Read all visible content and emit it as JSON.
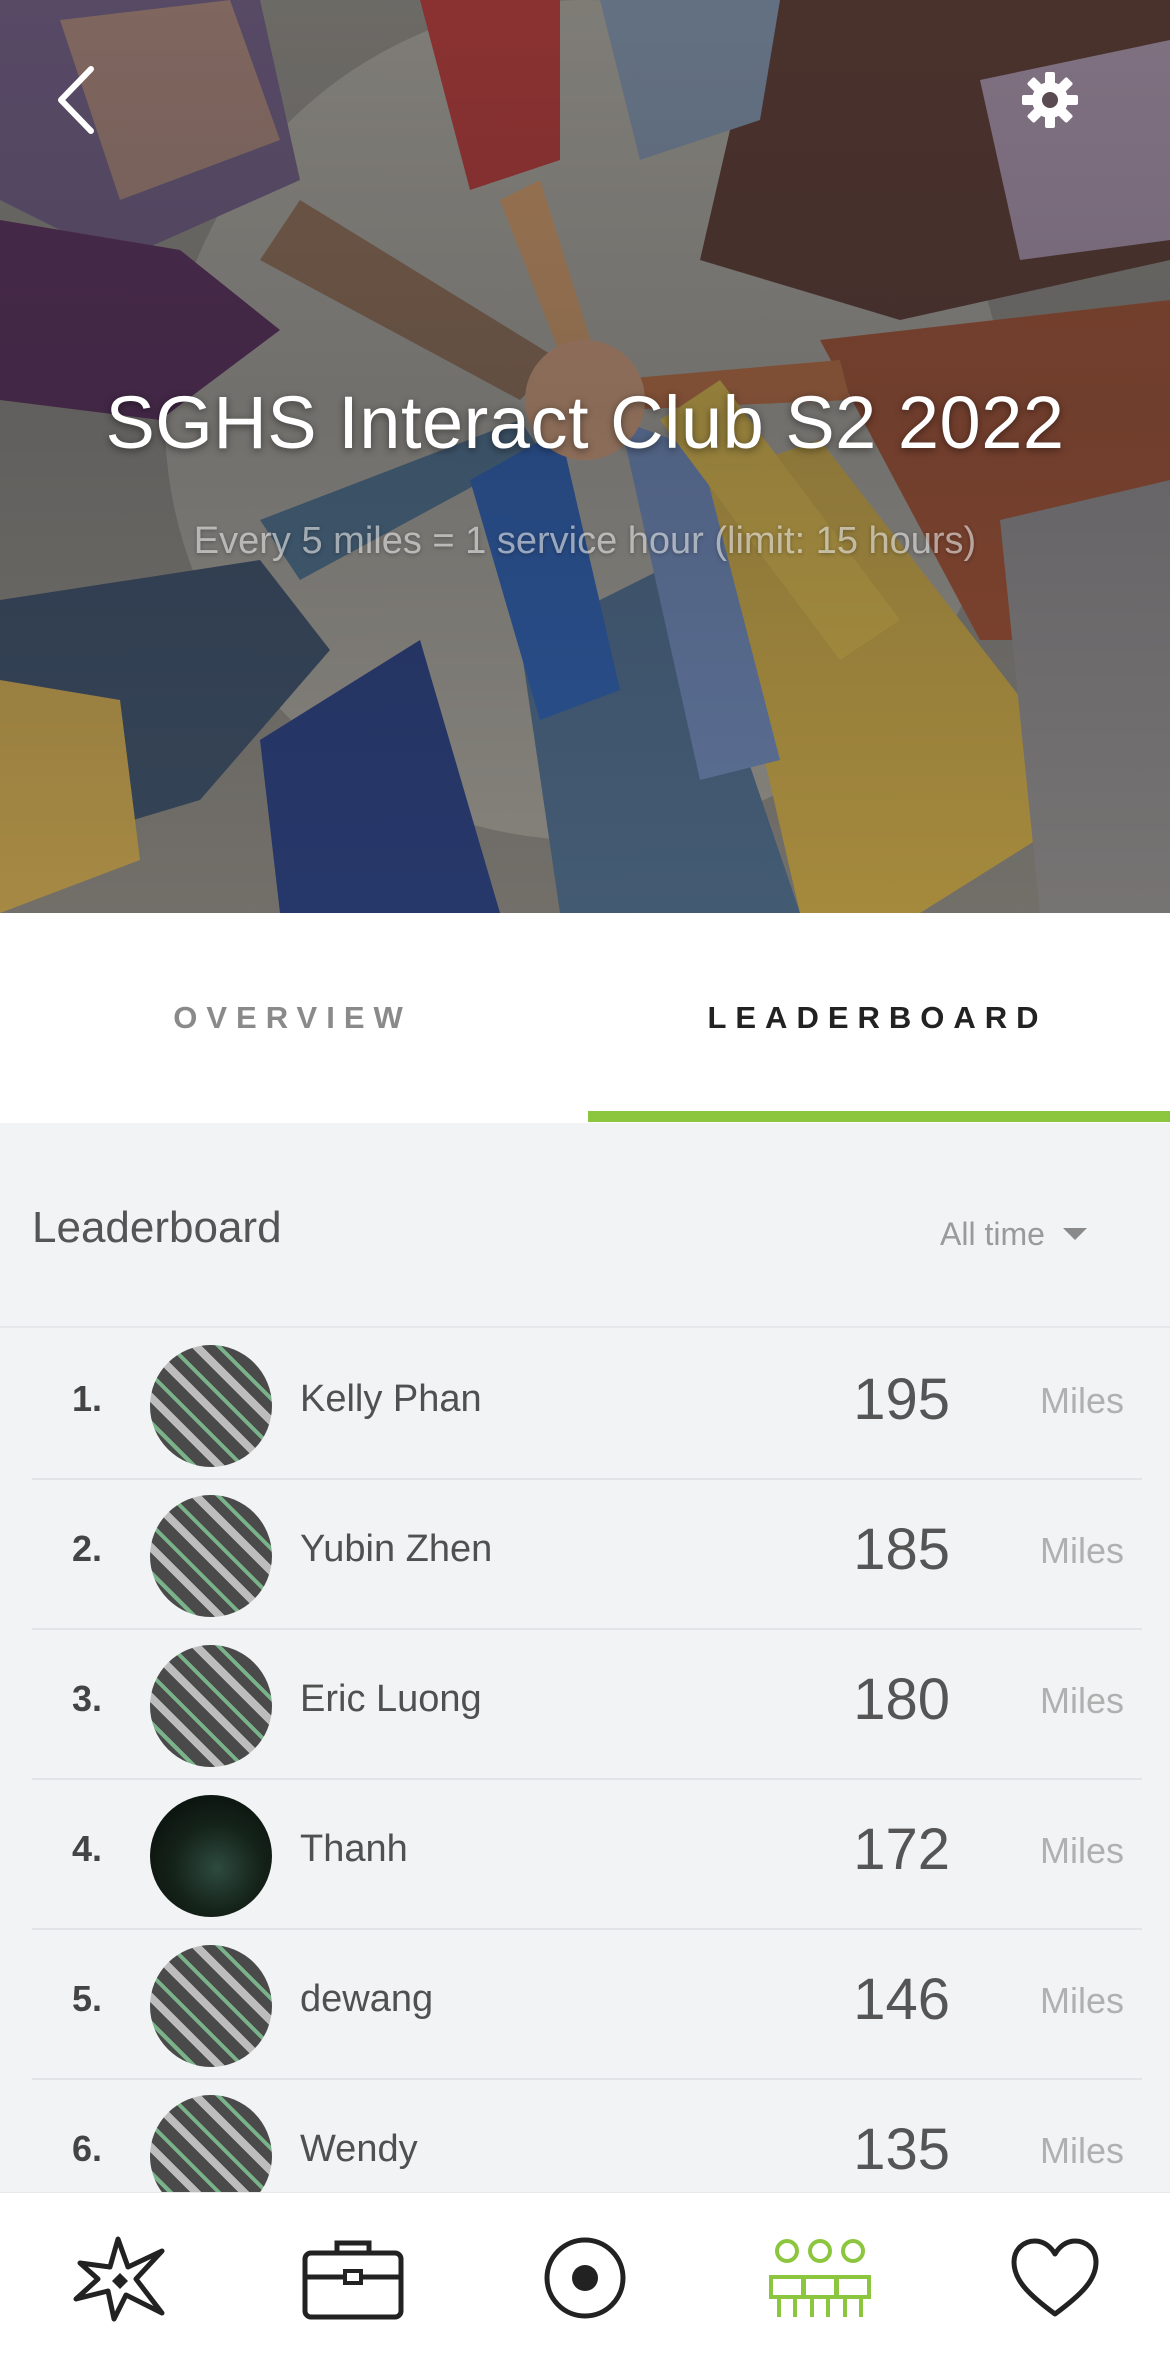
{
  "hero": {
    "title": "SGHS Interact Club S2 2022",
    "subtitle": "Every 5 miles = 1 service hour (limit: 15 hours)",
    "back_icon": "chevron-left-icon",
    "settings_icon": "gear-icon"
  },
  "tabs": [
    {
      "label": "OVERVIEW",
      "active": false
    },
    {
      "label": "LEADERBOARD",
      "active": true
    }
  ],
  "accent_color": "#8cc63f",
  "leaderboard": {
    "title": "Leaderboard",
    "filter_label": "All time",
    "unit": "Miles",
    "rows": [
      {
        "rank": "1.",
        "name": "Kelly Phan",
        "value": "195",
        "unit": "Miles",
        "avatar": "stripe"
      },
      {
        "rank": "2.",
        "name": "Yubin Zhen",
        "value": "185",
        "unit": "Miles",
        "avatar": "stripe"
      },
      {
        "rank": "3.",
        "name": "Eric Luong",
        "value": "180",
        "unit": "Miles",
        "avatar": "stripe"
      },
      {
        "rank": "4.",
        "name": "Thanh",
        "value": "172",
        "unit": "Miles",
        "avatar": "photo"
      },
      {
        "rank": "5.",
        "name": "dewang",
        "value": "146",
        "unit": "Miles",
        "avatar": "stripe"
      },
      {
        "rank": "6.",
        "name": "Wendy",
        "value": "135",
        "unit": "Miles",
        "avatar": "stripe"
      }
    ]
  },
  "bottom_nav": [
    {
      "icon": "burst-icon",
      "active": false
    },
    {
      "icon": "briefcase-icon",
      "active": false
    },
    {
      "icon": "record-icon",
      "active": false
    },
    {
      "icon": "team-icon",
      "active": true
    },
    {
      "icon": "heart-icon",
      "active": false
    }
  ]
}
